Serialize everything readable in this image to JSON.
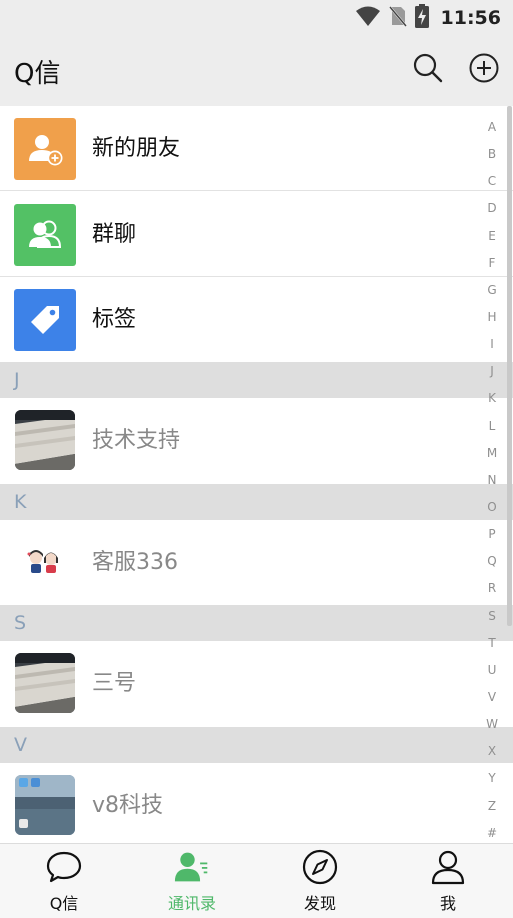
{
  "status_bar": {
    "time": "11:56",
    "icons": [
      "wifi-icon",
      "no-sim-icon",
      "battery-charging-icon"
    ]
  },
  "app_bar": {
    "title": "Q信",
    "actions": [
      "search-icon",
      "add-circle-icon"
    ]
  },
  "features": [
    {
      "label": "新的朋友",
      "icon": "add-friend-icon",
      "color": "#f0a04b"
    },
    {
      "label": "群聊",
      "icon": "group-chat-icon",
      "color": "#53c165"
    },
    {
      "label": "标签",
      "icon": "tag-icon",
      "color": "#3d82e8"
    }
  ],
  "sections": [
    {
      "letter": "J",
      "contacts": [
        {
          "name": "技术支持",
          "avatar": "keyboard-photo"
        }
      ]
    },
    {
      "letter": "K",
      "contacts": [
        {
          "name": "客服336",
          "avatar": "cartoon-couple"
        }
      ]
    },
    {
      "letter": "S",
      "contacts": [
        {
          "name": "三号",
          "avatar": "keyboard-photo"
        }
      ]
    },
    {
      "letter": "V",
      "contacts": [
        {
          "name": "v8科技",
          "avatar": "phone-homescreen"
        }
      ]
    }
  ],
  "index_letters": [
    "A",
    "B",
    "C",
    "D",
    "E",
    "F",
    "G",
    "H",
    "I",
    "J",
    "K",
    "L",
    "M",
    "N",
    "O",
    "P",
    "Q",
    "R",
    "S",
    "T",
    "U",
    "V",
    "W",
    "X",
    "Y",
    "Z",
    "#"
  ],
  "bottom_nav": [
    {
      "label": "Q信",
      "icon": "chat-bubble-icon",
      "active": false
    },
    {
      "label": "通讯录",
      "icon": "contacts-icon",
      "active": true
    },
    {
      "label": "发现",
      "icon": "compass-icon",
      "active": false
    },
    {
      "label": "我",
      "icon": "person-icon",
      "active": false
    }
  ],
  "colors": {
    "accent": "#4fb86a",
    "section_header_bg": "#dedede",
    "section_letter": "#8aa0b8",
    "contact_name": "#888888"
  }
}
